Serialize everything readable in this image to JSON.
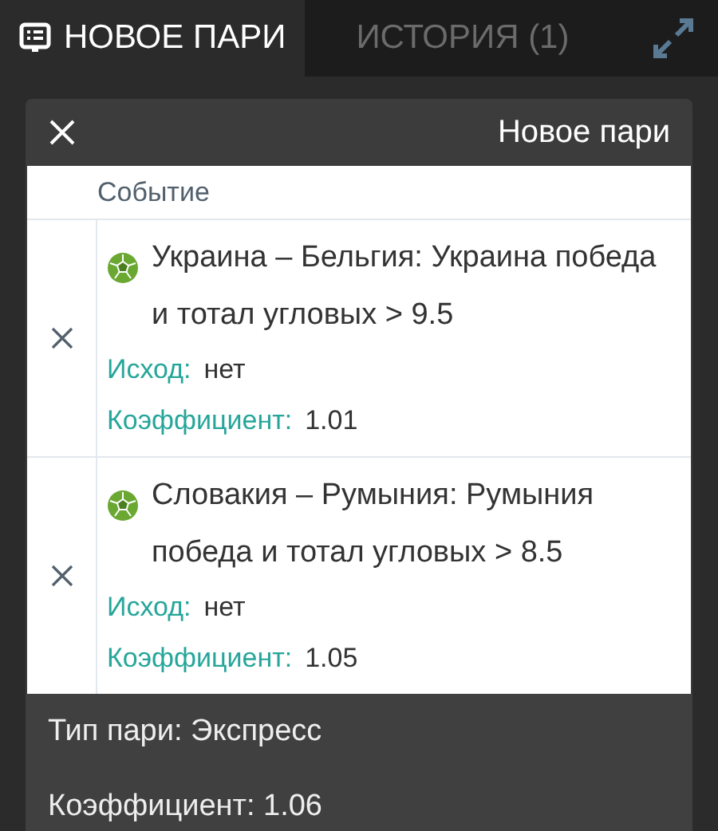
{
  "tabs": [
    {
      "label": "НОВОЕ ПАРИ",
      "selected": true
    },
    {
      "label": "ИСТОРИЯ (1)",
      "selected": false
    }
  ],
  "card": {
    "title": "Новое пари",
    "column_header": "Событие"
  },
  "events": [
    {
      "title": "Украина – Бельгия: Украина победа и тотал угловых > 9.5",
      "outcome_label": "Исход:",
      "outcome": "нет",
      "odds_label": "Коэффициент:",
      "odds": "1.01"
    },
    {
      "title": "Словакия – Румыния: Румыния победа и тотал угловых > 8.5",
      "outcome_label": "Исход:",
      "outcome": "нет",
      "odds_label": "Коэффициент:",
      "odds": "1.05"
    }
  ],
  "summary": {
    "bet_type": "Тип пари: Экспресс",
    "total_odds": "Коэффициент: 1.06"
  }
}
